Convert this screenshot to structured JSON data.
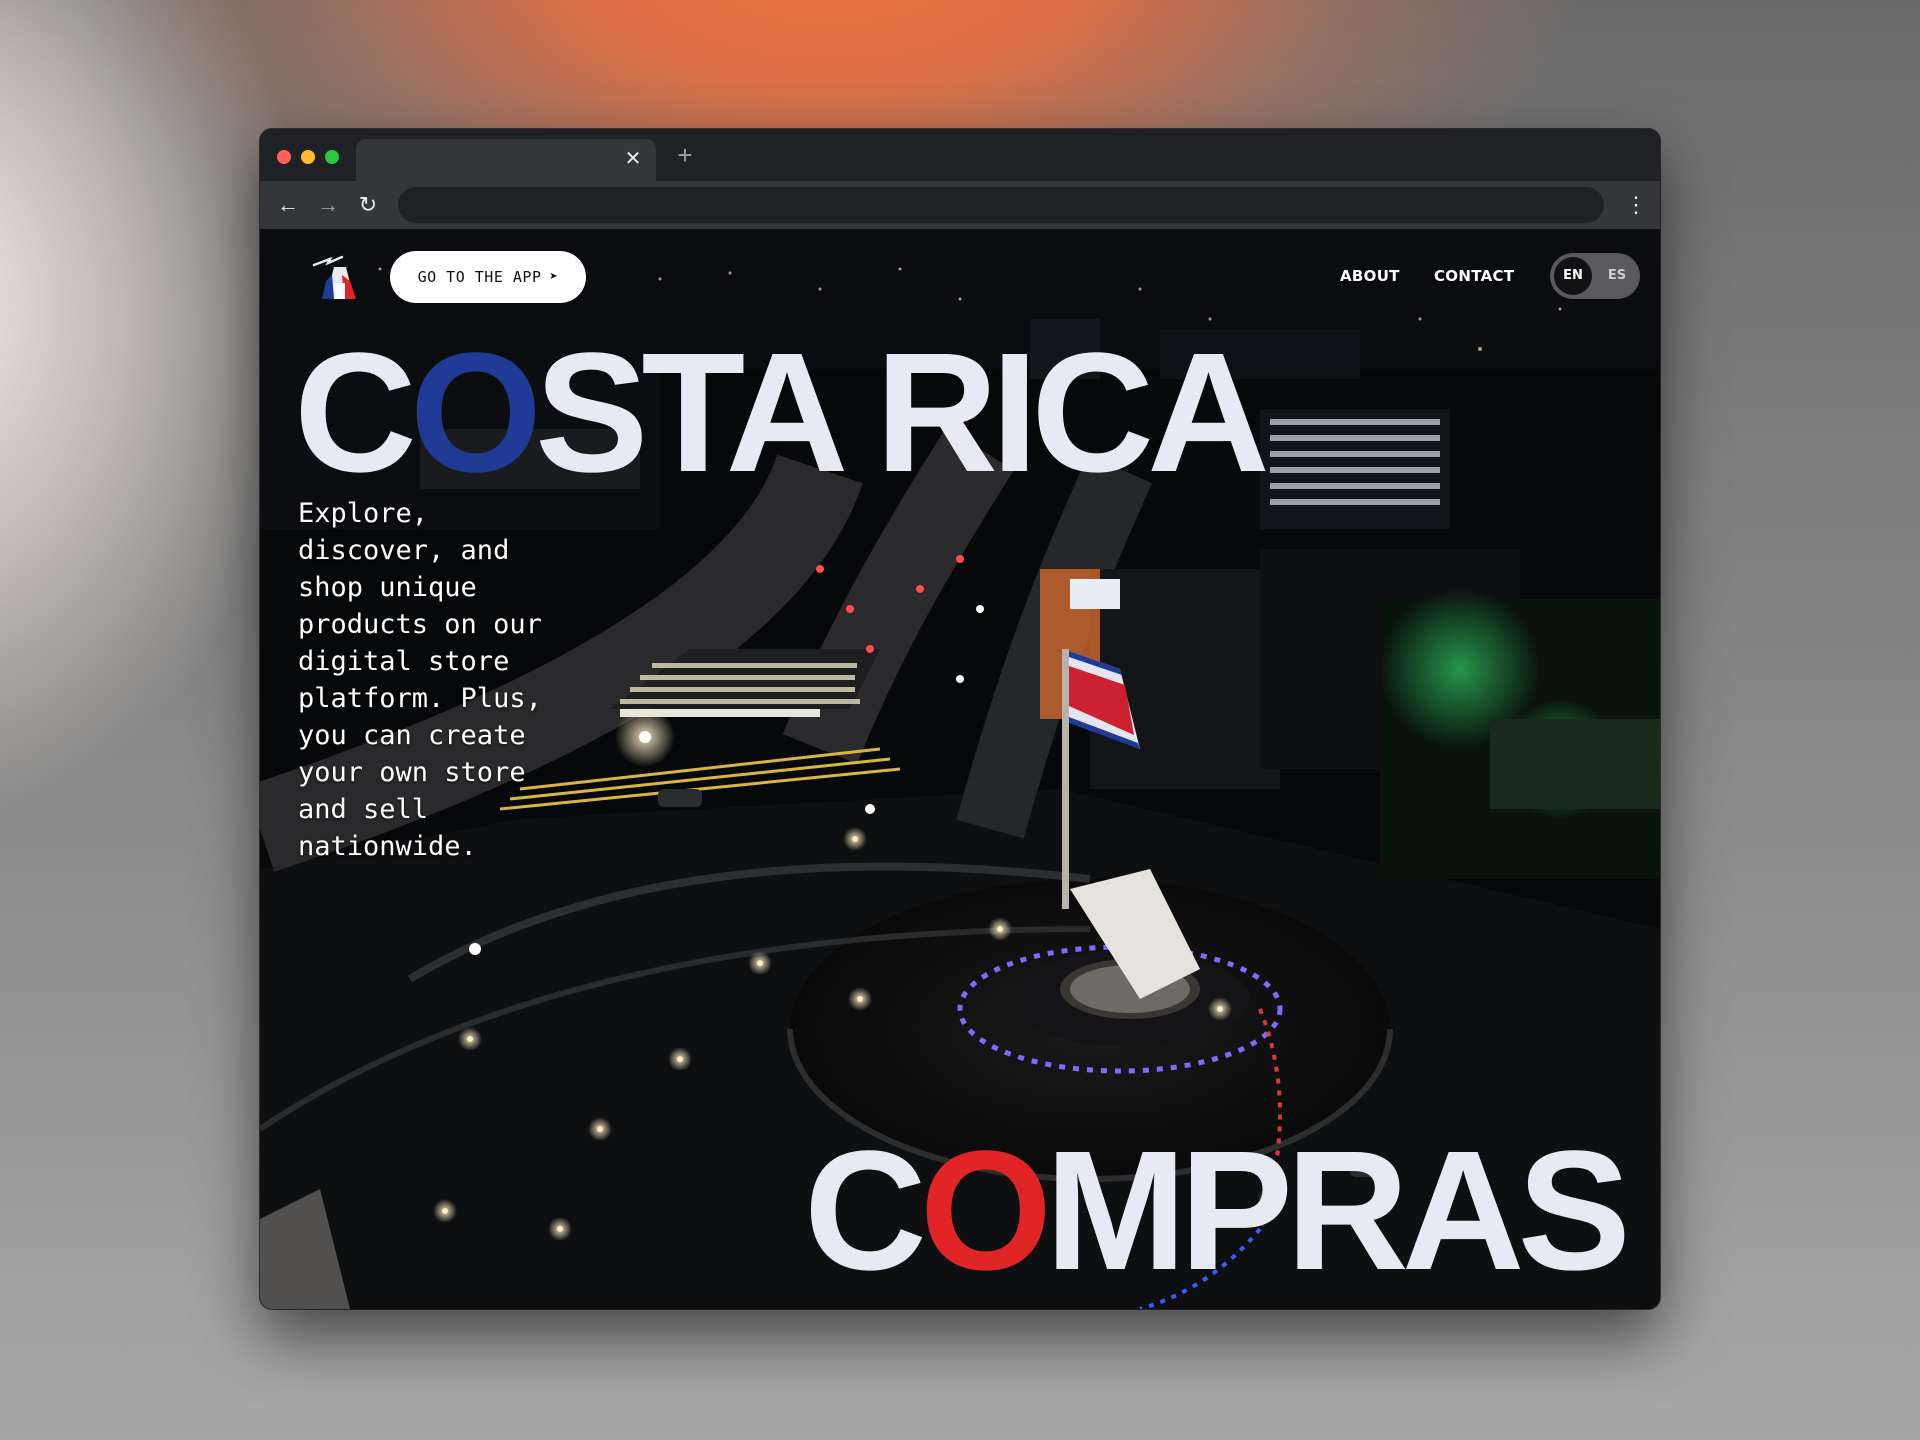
{
  "browser": {
    "tab_title": "",
    "tab_close_icon": "close-icon",
    "new_tab_icon": "plus-icon",
    "address": "",
    "menu_icon": "kebab-menu-icon"
  },
  "header": {
    "logo": "costa-rica-compras-logo",
    "app_button_label": "GO TO THE APP",
    "app_button_icon": "send-arrow-icon",
    "nav": [
      {
        "label": "ABOUT"
      },
      {
        "label": "CONTACT"
      }
    ],
    "lang": {
      "active": "EN",
      "inactive": "ES"
    }
  },
  "hero": {
    "title_pre": "C",
    "title_accent": "O",
    "title_post": "STA RICA",
    "subtitle_pre": "C",
    "subtitle_accent": "O",
    "subtitle_post": "MPRAS",
    "description": "Explore, discover, and shop unique products on our digital store platform. Plus, you can create your own store and sell nationwide.",
    "background": "night aerial photo of Costa Rica highway roundabout with national flag"
  },
  "colors": {
    "accent_blue": "#1f3b95",
    "accent_red": "#e12527",
    "title_text": "#e9e9f3"
  }
}
